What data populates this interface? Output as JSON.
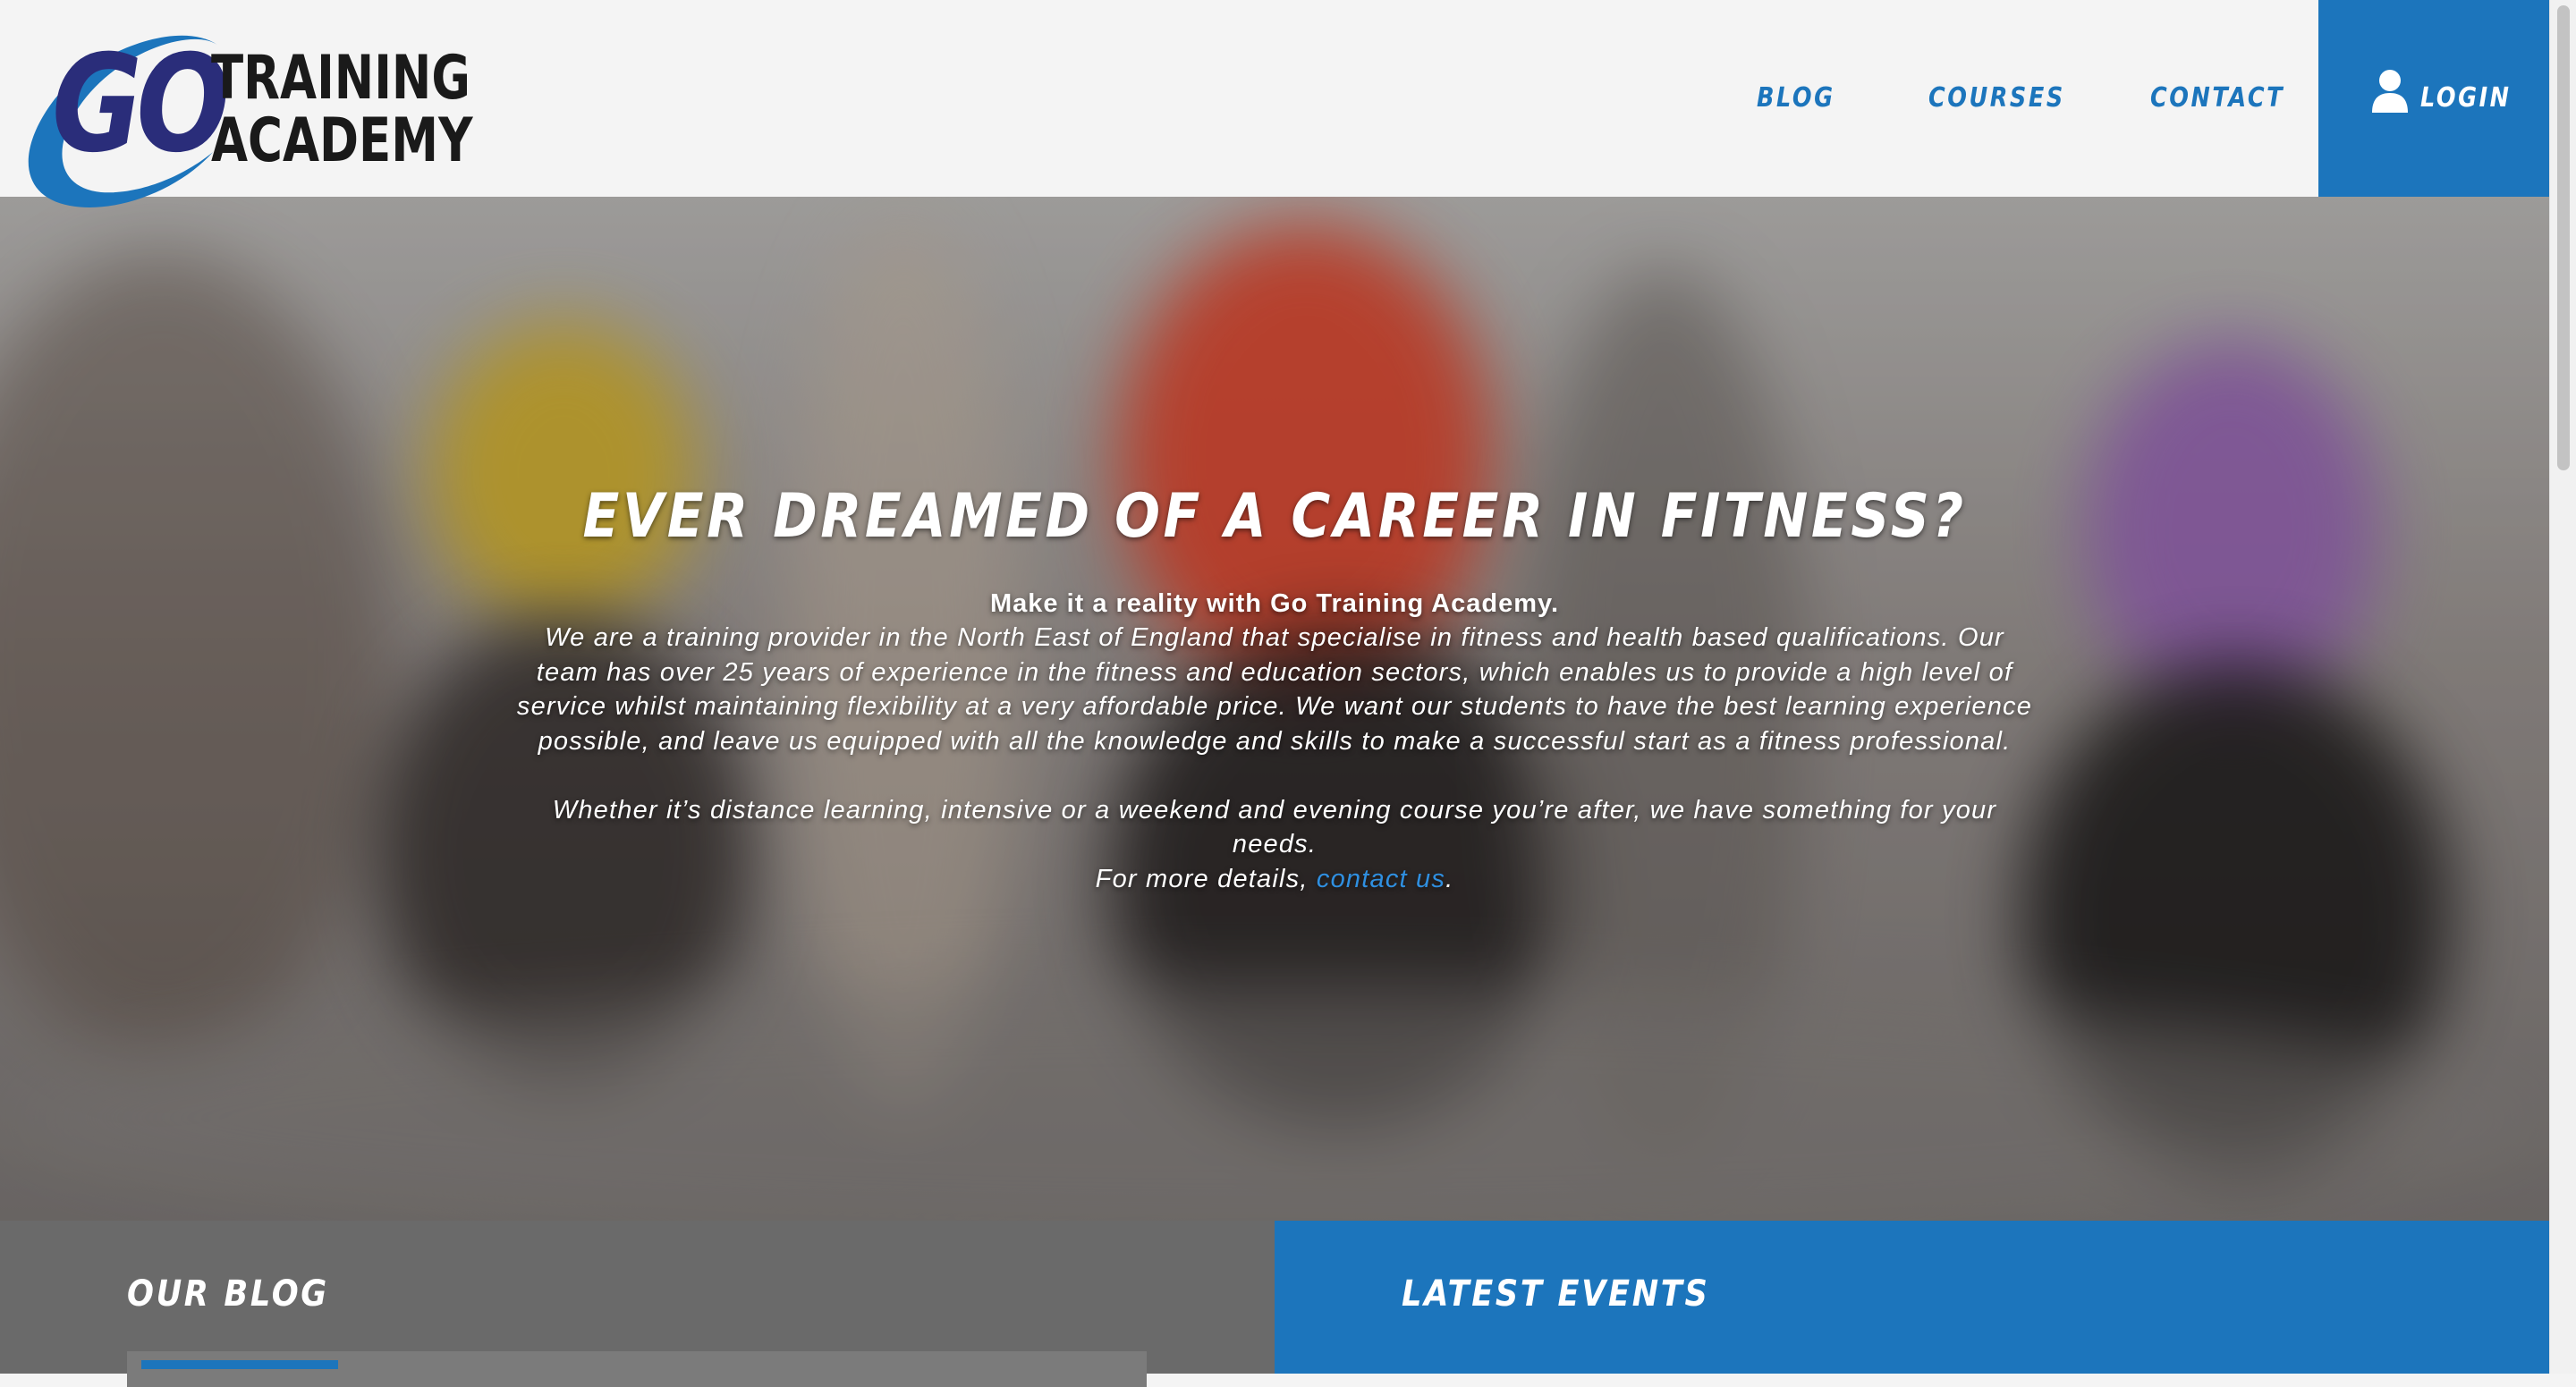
{
  "brand": {
    "logo_go": "GO",
    "logo_line1": "TRAINING",
    "logo_line2": "ACADEMY",
    "accent_color": "#1c75bc",
    "navy_color": "#2a2d7a"
  },
  "nav": {
    "items": [
      {
        "label": "BLOG"
      },
      {
        "label": "COURSES"
      },
      {
        "label": "CONTACT"
      }
    ],
    "login_label": "LOGIN",
    "login_icon": "user-icon"
  },
  "hero": {
    "title": "Ever dreamed of a career in fitness?",
    "lead": "Make it a reality with Go Training Academy.",
    "paragraph1": "We are a training provider in the North East of England that specialise in fitness and health based qualifications. Our team has over 25 years of experience in the fitness and education sectors, which enables us to provide a high level of service whilst maintaining flexibility at a very affordable price. We want our students to have the best learning experience possible, and leave us equipped with all the knowledge and skills to make a successful start as a fitness professional.",
    "paragraph2_line1": "Whether it’s distance learning, intensive or a weekend and evening course you’re after, we have something for your needs.",
    "paragraph2_prefix": "For more details, ",
    "contact_link": "contact us",
    "paragraph2_suffix": "."
  },
  "sections": {
    "blog_title": "Our Blog",
    "events_title": "Latest Events"
  }
}
